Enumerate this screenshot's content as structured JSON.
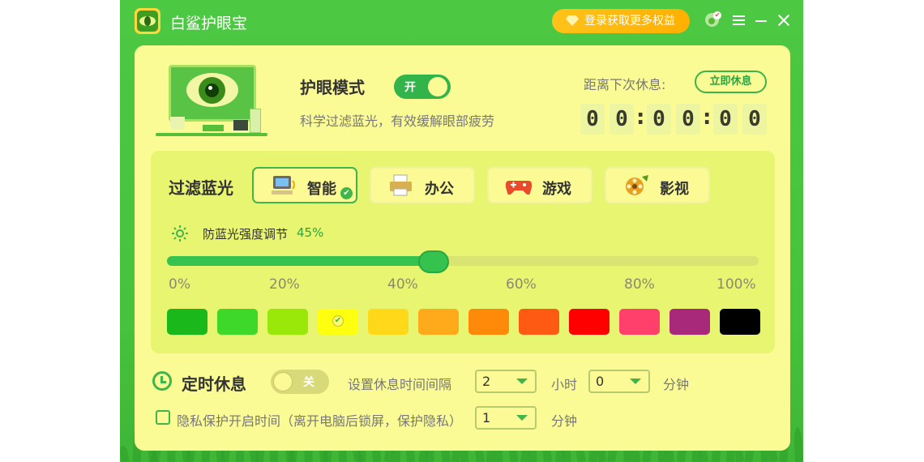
{
  "titlebar": {
    "app_title": "白鲨护眼宝",
    "login_label": "登录获取更多权益"
  },
  "eye_mode": {
    "title": "护眼模式",
    "toggle_label": "开",
    "toggle_on": true,
    "description": "科学过滤蓝光，有效缓解眼部疲劳"
  },
  "rest": {
    "label": "距离下次休息:",
    "rest_now_label": "立即休息",
    "digits": [
      "0",
      "0",
      "0",
      "0",
      "0",
      "0"
    ],
    "separator": ":"
  },
  "filter": {
    "title": "过滤蓝光",
    "modes": [
      {
        "label": "智能",
        "icon": "computer-icon",
        "selected": true
      },
      {
        "label": "办公",
        "icon": "printer-icon",
        "selected": false
      },
      {
        "label": "游戏",
        "icon": "gamepad-icon",
        "selected": false
      },
      {
        "label": "影视",
        "icon": "film-reel-icon",
        "selected": false
      }
    ],
    "intensity_label": "防蓝光强度调节",
    "intensity_value": "45%",
    "intensity_fraction": 0.45,
    "ticks": [
      "0%",
      "20%",
      "40%",
      "60%",
      "80%",
      "100%"
    ],
    "colors": [
      "#1ab81a",
      "#3ed82a",
      "#9ae80a",
      "#ffff10",
      "#ffd81a",
      "#ffaa1a",
      "#ff8a0a",
      "#ff5a14",
      "#ff0000",
      "#ff406a",
      "#a8287a",
      "#000000"
    ],
    "selected_color_index": 3
  },
  "timer": {
    "title": "定时休息",
    "toggle_label": "关",
    "toggle_on": false,
    "interval_label": "设置休息时间间隔",
    "hours_value": "2",
    "hours_unit": "小时",
    "minutes_value": "0",
    "minutes_unit": "分钟"
  },
  "privacy": {
    "label": "隐私保护开启时间（离开电脑后锁屏，保护隐私）",
    "checked": false,
    "value": "1",
    "unit": "分钟"
  }
}
